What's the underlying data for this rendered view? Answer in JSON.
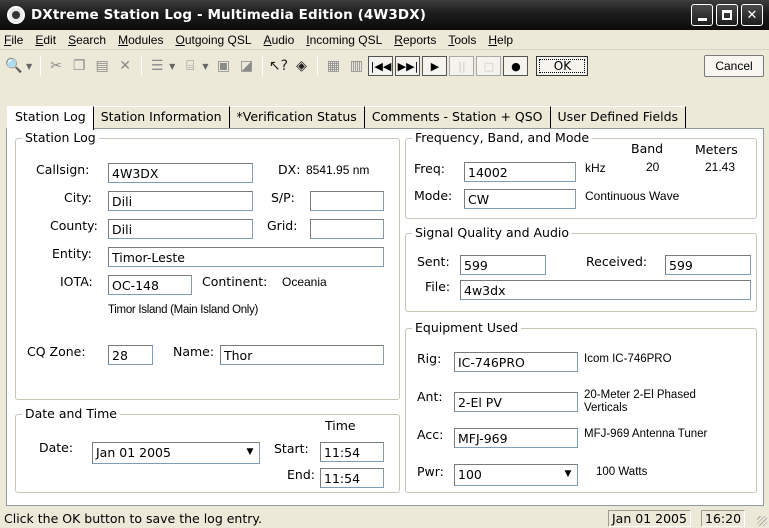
{
  "window": {
    "title": "DXtreme Station Log - Multimedia Edition (4W3DX)"
  },
  "menu": [
    {
      "pre": "",
      "ul": "F",
      "post": "ile"
    },
    {
      "pre": "",
      "ul": "E",
      "post": "dit"
    },
    {
      "pre": "",
      "ul": "S",
      "post": "earch"
    },
    {
      "pre": "",
      "ul": "M",
      "post": "odules"
    },
    {
      "pre": "",
      "ul": "O",
      "post": "utgoing QSL"
    },
    {
      "pre": "",
      "ul": "A",
      "post": "udio"
    },
    {
      "pre": "",
      "ul": "I",
      "post": "ncoming QSL"
    },
    {
      "pre": "",
      "ul": "R",
      "post": "eports"
    },
    {
      "pre": "",
      "ul": "T",
      "post": "ools"
    },
    {
      "pre": "",
      "ul": "H",
      "post": "elp"
    }
  ],
  "toolbar": {
    "ok_label": "OK",
    "cancel_label": "Cancel"
  },
  "tabs": [
    "Station Log",
    "Station Information",
    "*Verification Status",
    "Comments - Station + QSO",
    "User Defined Fields"
  ],
  "station_log": {
    "legend": "Station Log",
    "callsign_label": "Callsign:",
    "callsign": "4W3DX",
    "dx_label": "DX:",
    "dx_value": "8541.95 nm",
    "city_label": "City:",
    "city": "Dili",
    "sp_label": "S/P:",
    "sp": "",
    "county_label": "County:",
    "county": "Dili",
    "grid_label": "Grid:",
    "grid": "",
    "entity_label": "Entity:",
    "entity": "Timor-Leste",
    "iota_label": "IOTA:",
    "iota": "OC-148",
    "continent_label": "Continent:",
    "continent": "Oceania",
    "iota_desc": "Timor Island (Main Island Only)",
    "cq_label": "CQ Zone:",
    "cq_zone": "28",
    "name_label": "Name:",
    "name": "Thor"
  },
  "date_time": {
    "legend": "Date and Time",
    "time_header": "Time",
    "date_label": "Date:",
    "date": "Jan 01 2005",
    "start_label": "Start:",
    "start": "11:54",
    "end_label": "End:",
    "end": "11:54"
  },
  "frequency": {
    "legend": "Frequency, Band, and Mode",
    "band_header": "Band",
    "meters_header": "Meters",
    "freq_label": "Freq:",
    "freq": "14002",
    "freq_unit": "kHz",
    "band": "20",
    "meters": "21.43",
    "mode_label": "Mode:",
    "mode": "CW",
    "mode_desc": "Continuous Wave"
  },
  "signal": {
    "legend": "Signal Quality and Audio",
    "sent_label": "Sent:",
    "sent": "599",
    "received_label": "Received:",
    "received": "599",
    "file_label": "File:",
    "file": "4w3dx"
  },
  "equipment": {
    "legend": "Equipment Used",
    "rig_label": "Rig:",
    "rig": "IC-746PRO",
    "rig_desc": "Icom IC-746PRO",
    "ant_label": "Ant:",
    "ant": "2-El PV",
    "ant_desc": "20-Meter 2-El Phased Verticals",
    "acc_label": "Acc:",
    "acc": "MFJ-969",
    "acc_desc": "MFJ-969 Antenna Tuner",
    "pwr_label": "Pwr:",
    "pwr": "100",
    "pwr_desc": "100 Watts"
  },
  "status": {
    "message": "Click the OK button to save the log entry.",
    "date": "Jan 01 2005",
    "time": "16:20"
  }
}
